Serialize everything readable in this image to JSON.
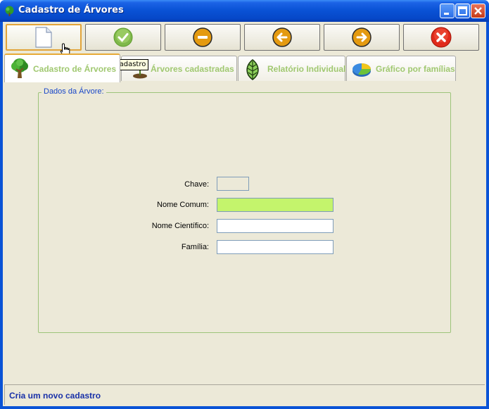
{
  "window": {
    "title": "Cadastro de Árvores",
    "title_color": "#ffffff",
    "frame_color": "#0a53d6"
  },
  "toolbar": {
    "buttons": [
      {
        "name": "new",
        "icon": "new-document-icon"
      },
      {
        "name": "save",
        "icon": "green-check-icon"
      },
      {
        "name": "delete",
        "icon": "orange-minus-icon"
      },
      {
        "name": "previous",
        "icon": "orange-left-arrow-icon"
      },
      {
        "name": "next",
        "icon": "orange-right-arrow-icon"
      },
      {
        "name": "cancel",
        "icon": "red-x-icon"
      }
    ],
    "tooltip": "Cria um novo cadastro"
  },
  "tabs": [
    {
      "label": "Cadastro de Árvores",
      "icon": "tree-icon",
      "active": true
    },
    {
      "label": "Árvores cadastradas",
      "icon": "sapling-icon",
      "active": false
    },
    {
      "label": "Relatório Individual",
      "icon": "leaf-icon",
      "active": false
    },
    {
      "label": "Gráfico por famílias",
      "icon": "pie-chart-icon",
      "active": false
    }
  ],
  "form": {
    "group_title": "Dados da Árvore:",
    "fields": {
      "chave": {
        "label": "Chave:",
        "value": ""
      },
      "nome_comum": {
        "label": "Nome Comum:",
        "value": ""
      },
      "nome_cientifico": {
        "label": "Nome Científico:",
        "value": ""
      },
      "familia": {
        "label": "Família:",
        "value": ""
      }
    }
  },
  "status": {
    "text": "Cria um novo cadastro"
  },
  "colors": {
    "tab_label": "#a0c870",
    "focused_field": "#c4f46c",
    "status_text": "#1830a8",
    "group_title": "#1846c8"
  }
}
